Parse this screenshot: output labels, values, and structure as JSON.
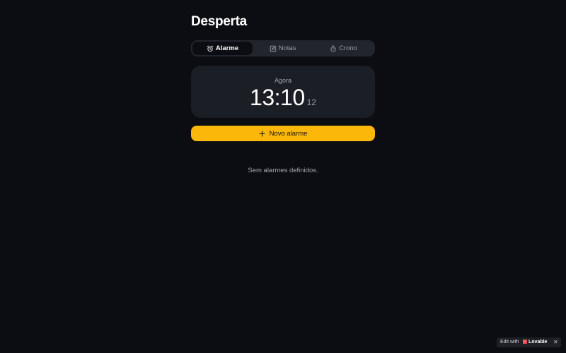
{
  "app": {
    "title": "Desperta"
  },
  "tabs": [
    {
      "label": "Alarme",
      "icon": "alarm-clock-icon",
      "active": true
    },
    {
      "label": "Notas",
      "icon": "edit-note-icon",
      "active": false
    },
    {
      "label": "Crono",
      "icon": "stopwatch-icon",
      "active": false
    }
  ],
  "clock": {
    "label": "Agora",
    "time": "13:10",
    "seconds": "12"
  },
  "new_alarm": {
    "label": "Novo alarme",
    "icon": "plus-icon"
  },
  "empty_state": {
    "text": "Sem alarmes definidos."
  },
  "badge": {
    "edit_label": "Edit with",
    "brand": "Lovable",
    "close": "✕"
  },
  "colors": {
    "background": "#0c0d12",
    "card": "#1c1e25",
    "tab_bar": "#23252d",
    "accent": "#fbb80a"
  }
}
